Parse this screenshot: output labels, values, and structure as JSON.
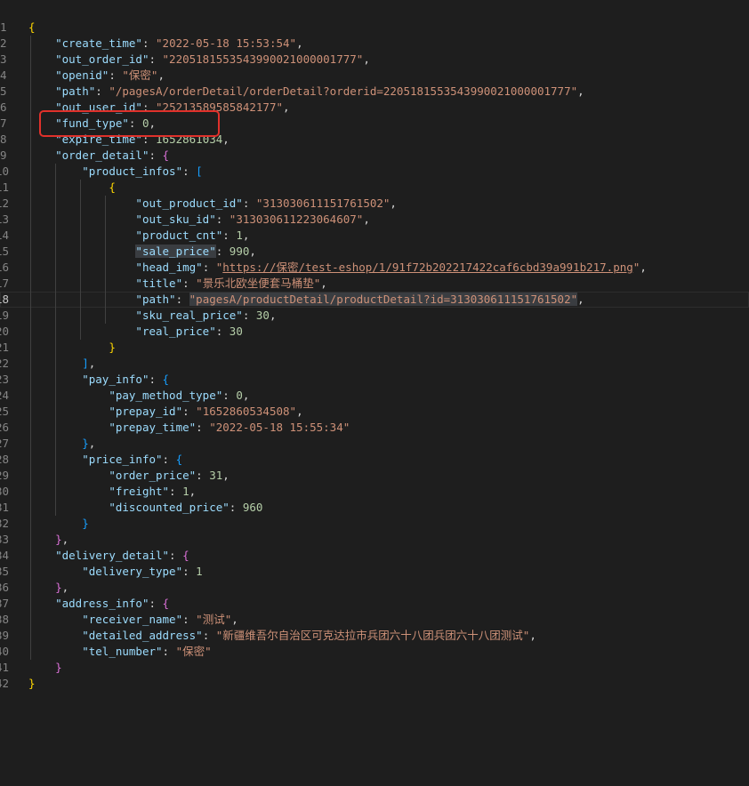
{
  "highlight_box_color": "#e0312b",
  "lines": [
    {
      "n": "1",
      "seg": [
        [
          "b1",
          "{"
        ]
      ]
    },
    {
      "n": "2",
      "seg": [
        [
          "p",
          "    "
        ],
        [
          "k",
          "\"create_time\""
        ],
        [
          "p",
          ": "
        ],
        [
          "s",
          "\"2022-05-18 15:53:54\""
        ],
        [
          "p",
          ","
        ]
      ]
    },
    {
      "n": "3",
      "seg": [
        [
          "p",
          "    "
        ],
        [
          "k",
          "\"out_order_id\""
        ],
        [
          "p",
          ": "
        ],
        [
          "s",
          "\"2205181553543990021000001777\""
        ],
        [
          "p",
          ","
        ]
      ]
    },
    {
      "n": "4",
      "seg": [
        [
          "p",
          "    "
        ],
        [
          "k",
          "\"openid\""
        ],
        [
          "p",
          ": "
        ],
        [
          "s",
          "\"保密\""
        ],
        [
          "p",
          ","
        ]
      ]
    },
    {
      "n": "5",
      "seg": [
        [
          "p",
          "    "
        ],
        [
          "k",
          "\"path\""
        ],
        [
          "p",
          ": "
        ],
        [
          "s",
          "\"/pagesA/orderDetail/orderDetail?orderid=2205181553543990021000001777\""
        ],
        [
          "p",
          ","
        ]
      ]
    },
    {
      "n": "6",
      "seg": [
        [
          "p",
          "    "
        ],
        [
          "k",
          "\"out_user_id\""
        ],
        [
          "p",
          ": "
        ],
        [
          "s",
          "\"25213589585842177\""
        ],
        [
          "p",
          ","
        ]
      ]
    },
    {
      "n": "7",
      "seg": [
        [
          "p",
          "    "
        ],
        [
          "k",
          "\"fund_type\""
        ],
        [
          "p",
          ": "
        ],
        [
          "n",
          "0"
        ],
        [
          "p",
          ","
        ]
      ]
    },
    {
      "n": "8",
      "seg": [
        [
          "p",
          "    "
        ],
        [
          "k",
          "\"expire_time\""
        ],
        [
          "p",
          ": "
        ],
        [
          "n",
          "1652861034"
        ],
        [
          "p",
          ","
        ]
      ]
    },
    {
      "n": "9",
      "seg": [
        [
          "p",
          "    "
        ],
        [
          "k",
          "\"order_detail\""
        ],
        [
          "p",
          ": "
        ],
        [
          "b2",
          "{"
        ]
      ]
    },
    {
      "n": "10",
      "seg": [
        [
          "p",
          "        "
        ],
        [
          "k",
          "\"product_infos\""
        ],
        [
          "p",
          ": "
        ],
        [
          "b3",
          "["
        ]
      ]
    },
    {
      "n": "11",
      "seg": [
        [
          "p",
          "            "
        ],
        [
          "b1",
          "{"
        ]
      ]
    },
    {
      "n": "12",
      "seg": [
        [
          "p",
          "                "
        ],
        [
          "k",
          "\"out_product_id\""
        ],
        [
          "p",
          ": "
        ],
        [
          "s",
          "\"313030611151761502\""
        ],
        [
          "p",
          ","
        ]
      ]
    },
    {
      "n": "13",
      "seg": [
        [
          "p",
          "                "
        ],
        [
          "k",
          "\"out_sku_id\""
        ],
        [
          "p",
          ": "
        ],
        [
          "s",
          "\"313030611223064607\""
        ],
        [
          "p",
          ","
        ]
      ]
    },
    {
      "n": "14",
      "seg": [
        [
          "p",
          "                "
        ],
        [
          "k",
          "\"product_cnt\""
        ],
        [
          "p",
          ": "
        ],
        [
          "n",
          "1"
        ],
        [
          "p",
          ","
        ]
      ]
    },
    {
      "n": "15",
      "seg": [
        [
          "p",
          "                "
        ],
        [
          "k hl",
          "\"sale_price\""
        ],
        [
          "p",
          ": "
        ],
        [
          "n",
          "990"
        ],
        [
          "p",
          ","
        ]
      ]
    },
    {
      "n": "16",
      "seg": [
        [
          "p",
          "                "
        ],
        [
          "k",
          "\"head_img\""
        ],
        [
          "p",
          ": "
        ],
        [
          "s",
          "\""
        ],
        [
          "s u",
          "https://保密/test-eshop/1/91f72b202217422caf6cbd39a991b217.png"
        ],
        [
          "s",
          "\""
        ],
        [
          "p",
          ","
        ]
      ]
    },
    {
      "n": "17",
      "seg": [
        [
          "p",
          "                "
        ],
        [
          "k",
          "\"title\""
        ],
        [
          "p",
          ": "
        ],
        [
          "s",
          "\"景乐北欧坐便套马桶垫\""
        ],
        [
          "p",
          ","
        ]
      ]
    },
    {
      "n": "18",
      "current": true,
      "seg": [
        [
          "p",
          "                "
        ],
        [
          "k",
          "\"path\""
        ],
        [
          "p",
          ": "
        ],
        [
          "s hl",
          "\"pagesA/productDetail/productDetail?id=313030611151761502\""
        ],
        [
          "p",
          ","
        ]
      ]
    },
    {
      "n": "19",
      "seg": [
        [
          "p",
          "                "
        ],
        [
          "k",
          "\"sku_real_price\""
        ],
        [
          "p",
          ": "
        ],
        [
          "n",
          "30"
        ],
        [
          "p",
          ","
        ]
      ]
    },
    {
      "n": "20",
      "seg": [
        [
          "p",
          "                "
        ],
        [
          "k",
          "\"real_price\""
        ],
        [
          "p",
          ": "
        ],
        [
          "n",
          "30"
        ]
      ]
    },
    {
      "n": "21",
      "seg": [
        [
          "p",
          "            "
        ],
        [
          "b1",
          "}"
        ]
      ]
    },
    {
      "n": "22",
      "seg": [
        [
          "p",
          "        "
        ],
        [
          "b3",
          "]"
        ],
        [
          "p",
          ","
        ]
      ]
    },
    {
      "n": "23",
      "seg": [
        [
          "p",
          "        "
        ],
        [
          "k",
          "\"pay_info\""
        ],
        [
          "p",
          ": "
        ],
        [
          "b3",
          "{"
        ]
      ]
    },
    {
      "n": "24",
      "seg": [
        [
          "p",
          "            "
        ],
        [
          "k",
          "\"pay_method_type\""
        ],
        [
          "p",
          ": "
        ],
        [
          "n",
          "0"
        ],
        [
          "p",
          ","
        ]
      ]
    },
    {
      "n": "25",
      "seg": [
        [
          "p",
          "            "
        ],
        [
          "k",
          "\"prepay_id\""
        ],
        [
          "p",
          ": "
        ],
        [
          "s",
          "\"1652860534508\""
        ],
        [
          "p",
          ","
        ]
      ]
    },
    {
      "n": "26",
      "seg": [
        [
          "p",
          "            "
        ],
        [
          "k",
          "\"prepay_time\""
        ],
        [
          "p",
          ": "
        ],
        [
          "s",
          "\"2022-05-18 15:55:34\""
        ]
      ]
    },
    {
      "n": "27",
      "seg": [
        [
          "p",
          "        "
        ],
        [
          "b3",
          "}"
        ],
        [
          "p",
          ","
        ]
      ]
    },
    {
      "n": "28",
      "seg": [
        [
          "p",
          "        "
        ],
        [
          "k",
          "\"price_info\""
        ],
        [
          "p",
          ": "
        ],
        [
          "b3",
          "{"
        ]
      ]
    },
    {
      "n": "29",
      "seg": [
        [
          "p",
          "            "
        ],
        [
          "k",
          "\"order_price\""
        ],
        [
          "p",
          ": "
        ],
        [
          "n",
          "31"
        ],
        [
          "p",
          ","
        ]
      ]
    },
    {
      "n": "30",
      "seg": [
        [
          "p",
          "            "
        ],
        [
          "k",
          "\"freight\""
        ],
        [
          "p",
          ": "
        ],
        [
          "n",
          "1"
        ],
        [
          "p",
          ","
        ]
      ]
    },
    {
      "n": "31",
      "seg": [
        [
          "p",
          "            "
        ],
        [
          "k",
          "\"discounted_price\""
        ],
        [
          "p",
          ": "
        ],
        [
          "n",
          "960"
        ]
      ]
    },
    {
      "n": "32",
      "seg": [
        [
          "p",
          "        "
        ],
        [
          "b3",
          "}"
        ]
      ]
    },
    {
      "n": "33",
      "seg": [
        [
          "p",
          "    "
        ],
        [
          "b2",
          "}"
        ],
        [
          "p",
          ","
        ]
      ]
    },
    {
      "n": "34",
      "seg": [
        [
          "p",
          "    "
        ],
        [
          "k",
          "\"delivery_detail\""
        ],
        [
          "p",
          ": "
        ],
        [
          "b2",
          "{"
        ]
      ]
    },
    {
      "n": "35",
      "seg": [
        [
          "p",
          "        "
        ],
        [
          "k",
          "\"delivery_type\""
        ],
        [
          "p",
          ": "
        ],
        [
          "n",
          "1"
        ]
      ]
    },
    {
      "n": "36",
      "seg": [
        [
          "p",
          "    "
        ],
        [
          "b2",
          "}"
        ],
        [
          "p",
          ","
        ]
      ]
    },
    {
      "n": "37",
      "seg": [
        [
          "p",
          "    "
        ],
        [
          "k",
          "\"address_info\""
        ],
        [
          "p",
          ": "
        ],
        [
          "b2",
          "{"
        ]
      ]
    },
    {
      "n": "38",
      "seg": [
        [
          "p",
          "        "
        ],
        [
          "k",
          "\"receiver_name\""
        ],
        [
          "p",
          ": "
        ],
        [
          "s",
          "\"测试\""
        ],
        [
          "p",
          ","
        ]
      ]
    },
    {
      "n": "39",
      "seg": [
        [
          "p",
          "        "
        ],
        [
          "k",
          "\"detailed_address\""
        ],
        [
          "p",
          ": "
        ],
        [
          "s",
          "\"新疆维吾尔自治区可克达拉市兵团六十八团兵团六十八团测试\""
        ],
        [
          "p",
          ","
        ]
      ]
    },
    {
      "n": "40",
      "seg": [
        [
          "p",
          "        "
        ],
        [
          "k",
          "\"tel_number\""
        ],
        [
          "p",
          ": "
        ],
        [
          "s",
          "\"保密\""
        ]
      ]
    },
    {
      "n": "41",
      "seg": [
        [
          "p",
          "    "
        ],
        [
          "b2",
          "}"
        ]
      ]
    },
    {
      "n": "42",
      "seg": [
        [
          "b1",
          "}"
        ]
      ]
    }
  ]
}
